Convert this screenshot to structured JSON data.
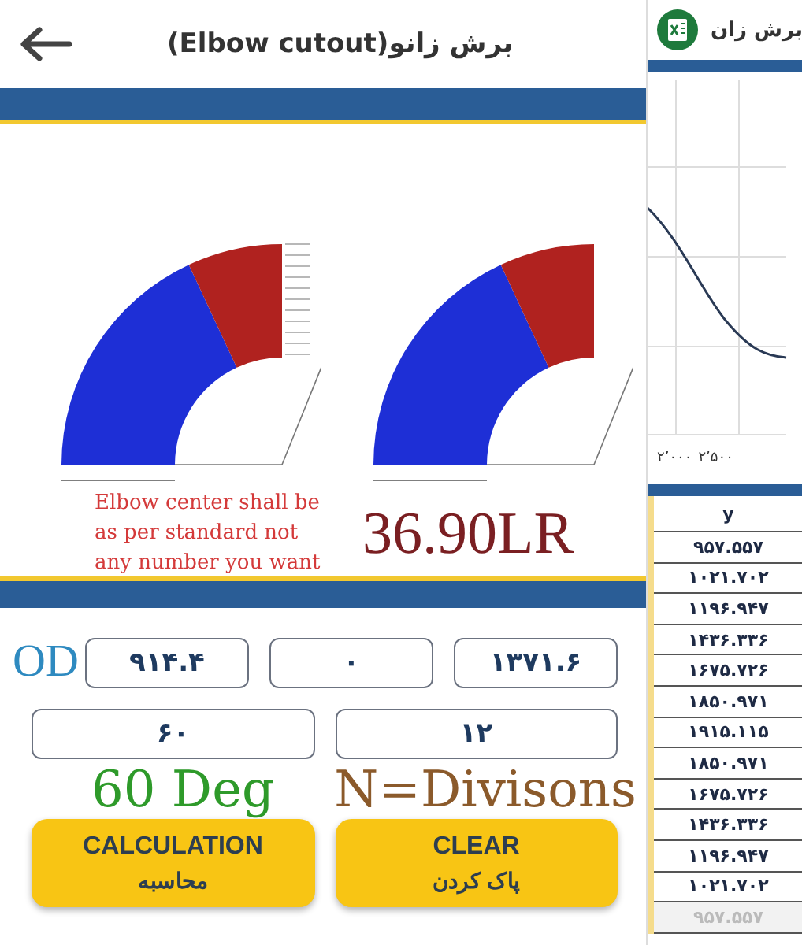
{
  "main_screen": {
    "title": "برش زانو(Elbow cutout)",
    "note": "Elbow center shall be as per standard not any number you want",
    "result": "36.90LR",
    "od_label": "OD",
    "inputs_row_1": [
      {
        "value": "۱۳۷۱.۶"
      },
      {
        "value": "۰"
      },
      {
        "value": "۹۱۴.۴"
      }
    ],
    "inputs_row_2": [
      {
        "value": "۱۲"
      },
      {
        "value": "۶۰"
      }
    ],
    "angle_label": "60 Deg",
    "divisions_label": "N=Divisons",
    "buttons": [
      {
        "label": "CLEAR",
        "sublabel": "پاک کردن"
      },
      {
        "label": "CALCULATION",
        "sublabel": "محاسبه"
      }
    ]
  },
  "side_screen": {
    "title": "برش زان",
    "x_tick_labels": [
      "۲٬۵۰۰",
      "۲٬۰۰۰"
    ],
    "table": {
      "columns": [
        "y"
      ],
      "rows": [
        "۹۵۷.۵۵۷",
        "۱۰۲۱.۷۰۲",
        "۱۱۹۶.۹۴۷",
        "۱۴۳۶.۳۳۶",
        "۱۶۷۵.۷۲۶",
        "۱۸۵۰.۹۷۱",
        "۱۹۱۵.۱۱۵",
        "۱۸۵۰.۹۷۱",
        "۱۶۷۵.۷۲۶",
        "۱۴۳۶.۳۳۶",
        "۱۱۹۶.۹۴۷",
        "۱۰۲۱.۷۰۲",
        "۹۵۷.۵۵۷"
      ]
    }
  }
}
